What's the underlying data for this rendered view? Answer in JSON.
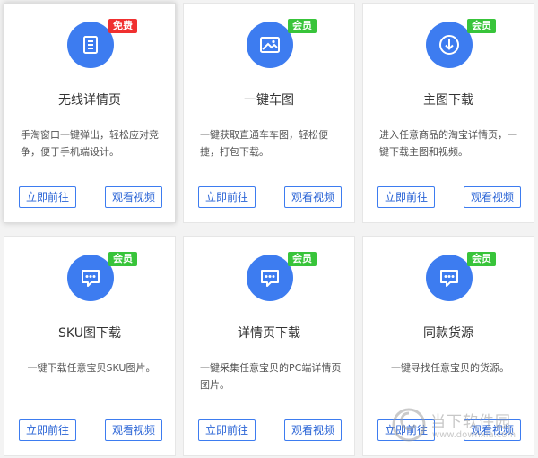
{
  "cards": [
    {
      "title": "无线详情页",
      "badge": "免费",
      "badge_type": "free",
      "icon": "document-icon",
      "desc": "手淘窗口一键弹出，轻松应对竞争，便于手机端设计。",
      "btn_go": "立即前往",
      "btn_video": "观看视频"
    },
    {
      "title": "一键车图",
      "badge": "会员",
      "badge_type": "member",
      "icon": "image-icon",
      "desc": "一键获取直通车车图，轻松便捷，打包下载。",
      "btn_go": "立即前往",
      "btn_video": "观看视频"
    },
    {
      "title": "主图下载",
      "badge": "会员",
      "badge_type": "member",
      "icon": "download-icon",
      "desc": "进入任意商品的淘宝详情页，一键下载主图和视频。",
      "btn_go": "立即前往",
      "btn_video": "观看视频"
    },
    {
      "title": "SKU图下载",
      "badge": "会员",
      "badge_type": "member",
      "icon": "message-icon",
      "desc": "一键下载任意宝贝SKU图片。",
      "btn_go": "立即前往",
      "btn_video": "观看视频"
    },
    {
      "title": "详情页下载",
      "badge": "会员",
      "badge_type": "member",
      "icon": "message-icon",
      "desc": "一键采集任意宝贝的PC端详情页图片。",
      "btn_go": "立即前往",
      "btn_video": "观看视频"
    },
    {
      "title": "同款货源",
      "badge": "会员",
      "badge_type": "member",
      "icon": "message-icon",
      "desc": "一键寻找任意宝贝的货源。",
      "btn_go": "立即前往",
      "btn_video": "观看视频"
    }
  ],
  "watermark": {
    "text": "当下软件园",
    "url": "www.downxia.com"
  },
  "colors": {
    "accent": "#3d7cf0",
    "free_badge": "#f03030",
    "member_badge": "#38c43a"
  }
}
